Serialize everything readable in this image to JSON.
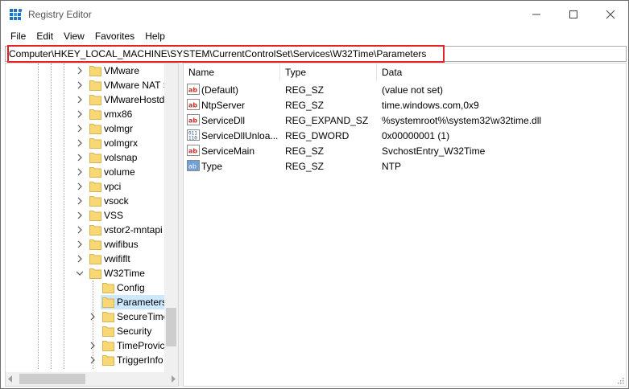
{
  "window": {
    "title": "Registry Editor",
    "controls": {
      "minimize": "minimize",
      "maximize": "maximize",
      "close": "close"
    }
  },
  "menu": {
    "items": [
      "File",
      "Edit",
      "View",
      "Favorites",
      "Help"
    ]
  },
  "address": {
    "path": "Computer\\HKEY_LOCAL_MACHINE\\SYSTEM\\CurrentControlSet\\Services\\W32Time\\Parameters",
    "highlight_color": "#e32424"
  },
  "tree": {
    "items": [
      {
        "label": "VMware",
        "level": 1,
        "expanded": false,
        "has_children": true,
        "selected": false
      },
      {
        "label": "VMware NAT S",
        "level": 1,
        "expanded": false,
        "has_children": true,
        "selected": false
      },
      {
        "label": "VMwareHostd",
        "level": 1,
        "expanded": false,
        "has_children": true,
        "selected": false
      },
      {
        "label": "vmx86",
        "level": 1,
        "expanded": false,
        "has_children": true,
        "selected": false
      },
      {
        "label": "volmgr",
        "level": 1,
        "expanded": false,
        "has_children": true,
        "selected": false
      },
      {
        "label": "volmgrx",
        "level": 1,
        "expanded": false,
        "has_children": true,
        "selected": false
      },
      {
        "label": "volsnap",
        "level": 1,
        "expanded": false,
        "has_children": true,
        "selected": false
      },
      {
        "label": "volume",
        "level": 1,
        "expanded": false,
        "has_children": true,
        "selected": false
      },
      {
        "label": "vpci",
        "level": 1,
        "expanded": false,
        "has_children": true,
        "selected": false
      },
      {
        "label": "vsock",
        "level": 1,
        "expanded": false,
        "has_children": true,
        "selected": false
      },
      {
        "label": "VSS",
        "level": 1,
        "expanded": false,
        "has_children": true,
        "selected": false
      },
      {
        "label": "vstor2-mntapi",
        "level": 1,
        "expanded": false,
        "has_children": true,
        "selected": false
      },
      {
        "label": "vwifibus",
        "level": 1,
        "expanded": false,
        "has_children": true,
        "selected": false
      },
      {
        "label": "vwififlt",
        "level": 1,
        "expanded": false,
        "has_children": true,
        "selected": false
      },
      {
        "label": "W32Time",
        "level": 1,
        "expanded": true,
        "has_children": true,
        "selected": false
      },
      {
        "label": "Config",
        "level": 2,
        "expanded": false,
        "has_children": false,
        "selected": false
      },
      {
        "label": "Parameters",
        "level": 2,
        "expanded": false,
        "has_children": false,
        "selected": true
      },
      {
        "label": "SecureTime",
        "level": 2,
        "expanded": false,
        "has_children": true,
        "selected": false
      },
      {
        "label": "Security",
        "level": 2,
        "expanded": false,
        "has_children": false,
        "selected": false
      },
      {
        "label": "TimeProvic",
        "level": 2,
        "expanded": false,
        "has_children": true,
        "selected": false
      },
      {
        "label": "TriggerInfo",
        "level": 2,
        "expanded": false,
        "has_children": true,
        "selected": false
      }
    ]
  },
  "list": {
    "columns": {
      "name": "Name",
      "type": "Type",
      "data": "Data"
    },
    "rows": [
      {
        "icon": "string-value-icon",
        "name": "(Default)",
        "type": "REG_SZ",
        "data": "(value not set)"
      },
      {
        "icon": "string-value-icon",
        "name": "NtpServer",
        "type": "REG_SZ",
        "data": "time.windows.com,0x9"
      },
      {
        "icon": "string-value-icon",
        "name": "ServiceDll",
        "type": "REG_EXPAND_SZ",
        "data": "%systemroot%\\system32\\w32time.dll"
      },
      {
        "icon": "binary-value-icon",
        "name": "ServiceDllUnloa...",
        "type": "REG_DWORD",
        "data": "0x00000001 (1)"
      },
      {
        "icon": "string-value-icon",
        "name": "ServiceMain",
        "type": "REG_SZ",
        "data": "SvchostEntry_W32Time"
      },
      {
        "icon": "type-value-icon",
        "name": "Type",
        "type": "REG_SZ",
        "data": "NTP"
      }
    ]
  },
  "colors": {
    "selection": "#cce8ff",
    "folder": "#f8d775",
    "string_icon": "#c7302a",
    "binary_icon": "#2b5797"
  }
}
